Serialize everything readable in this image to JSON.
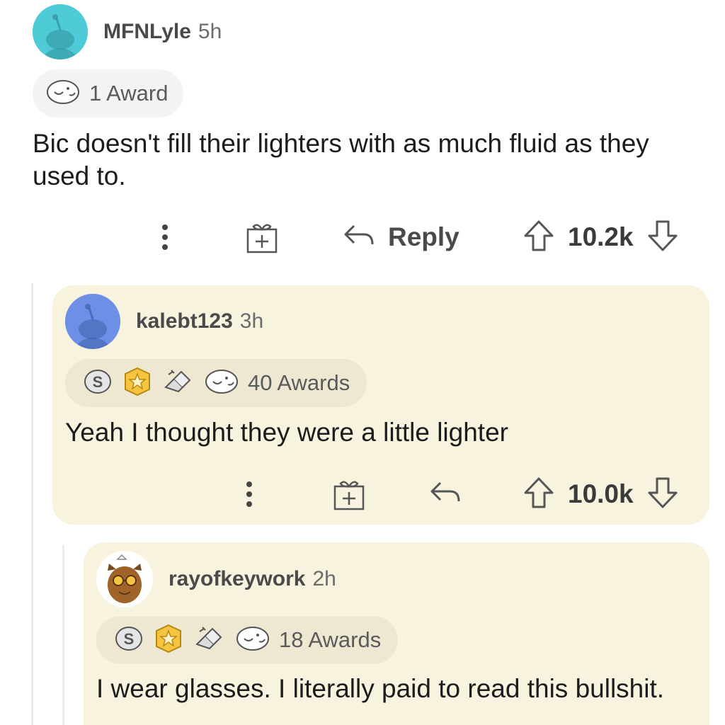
{
  "comments": [
    {
      "username": "MFNLyle",
      "time": "5h",
      "awards": "1 Award",
      "body": "Bic doesn't fill their lighters with as much fluid as they used to.",
      "reply_label": "Reply",
      "votes": "10.2k"
    },
    {
      "username": "kalebt123",
      "time": "3h",
      "awards": "40 Awards",
      "body": "Yeah I thought they were a little lighter",
      "votes": "10.0k"
    },
    {
      "username": "rayofkeywork",
      "time": "2h",
      "awards": "18 Awards",
      "body": "I wear glasses. I literally paid to read this bullshit."
    }
  ],
  "icons": {
    "more": "more-options-icon",
    "gift": "gift-icon",
    "reply": "reply-arrow-icon",
    "upvote": "upvote-arrow-icon",
    "downvote": "downvote-arrow-icon",
    "silver": "silver-award-icon",
    "gold": "gold-award-icon",
    "wholesome": "wholesome-award-icon",
    "helpful": "helpful-award-icon"
  },
  "colors": {
    "nested_background": "#f8f3df",
    "award_pill_top": "#f3f3f3",
    "award_pill_nested": "#eee8d2",
    "avatar_teal": "#4fcbd8",
    "avatar_blue": "#6e8fe6"
  }
}
